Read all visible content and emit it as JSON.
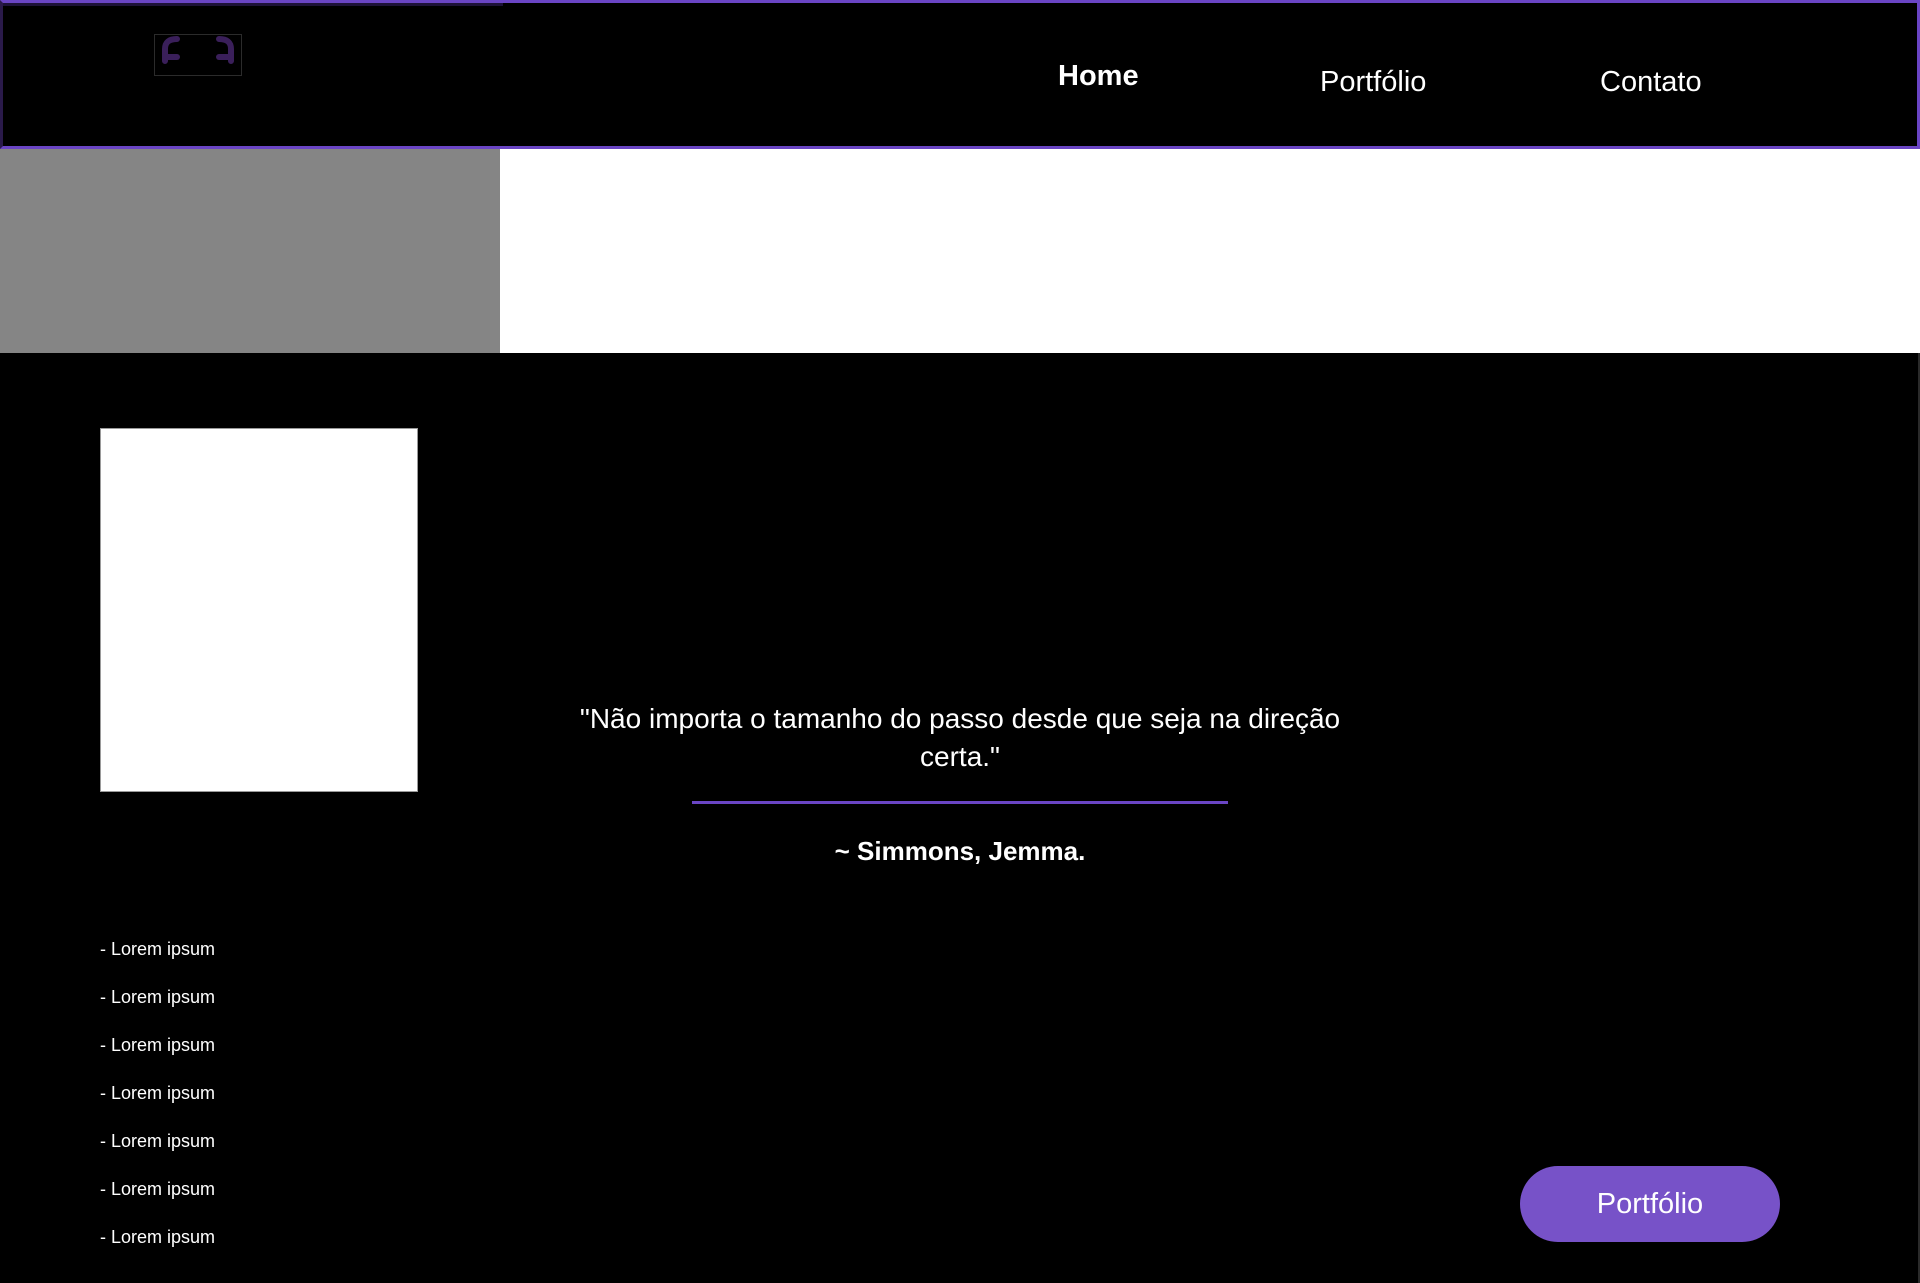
{
  "header": {
    "logo_icon": "bracket-logo-icon",
    "nav": [
      {
        "label": "Home",
        "active": true
      },
      {
        "label": "Portfólio",
        "active": false
      },
      {
        "label": "Contato",
        "active": false
      }
    ]
  },
  "sidebar": {
    "items": [
      "- Lorem ipsum",
      "- Lorem ipsum",
      "- Lorem ipsum",
      "- Lorem ipsum",
      "- Lorem ipsum",
      "- Lorem ipsum",
      "- Lorem ipsum"
    ]
  },
  "quote": {
    "text": "\"Não importa o tamanho do passo desde que seja na direção certa.\"",
    "author": "~ Simmons, Jemma."
  },
  "cta": {
    "label": "Portfólio"
  },
  "colors": {
    "accent": "#7752c8",
    "background": "#000000",
    "banner_gray": "#858585",
    "banner_white": "#ffffff"
  }
}
